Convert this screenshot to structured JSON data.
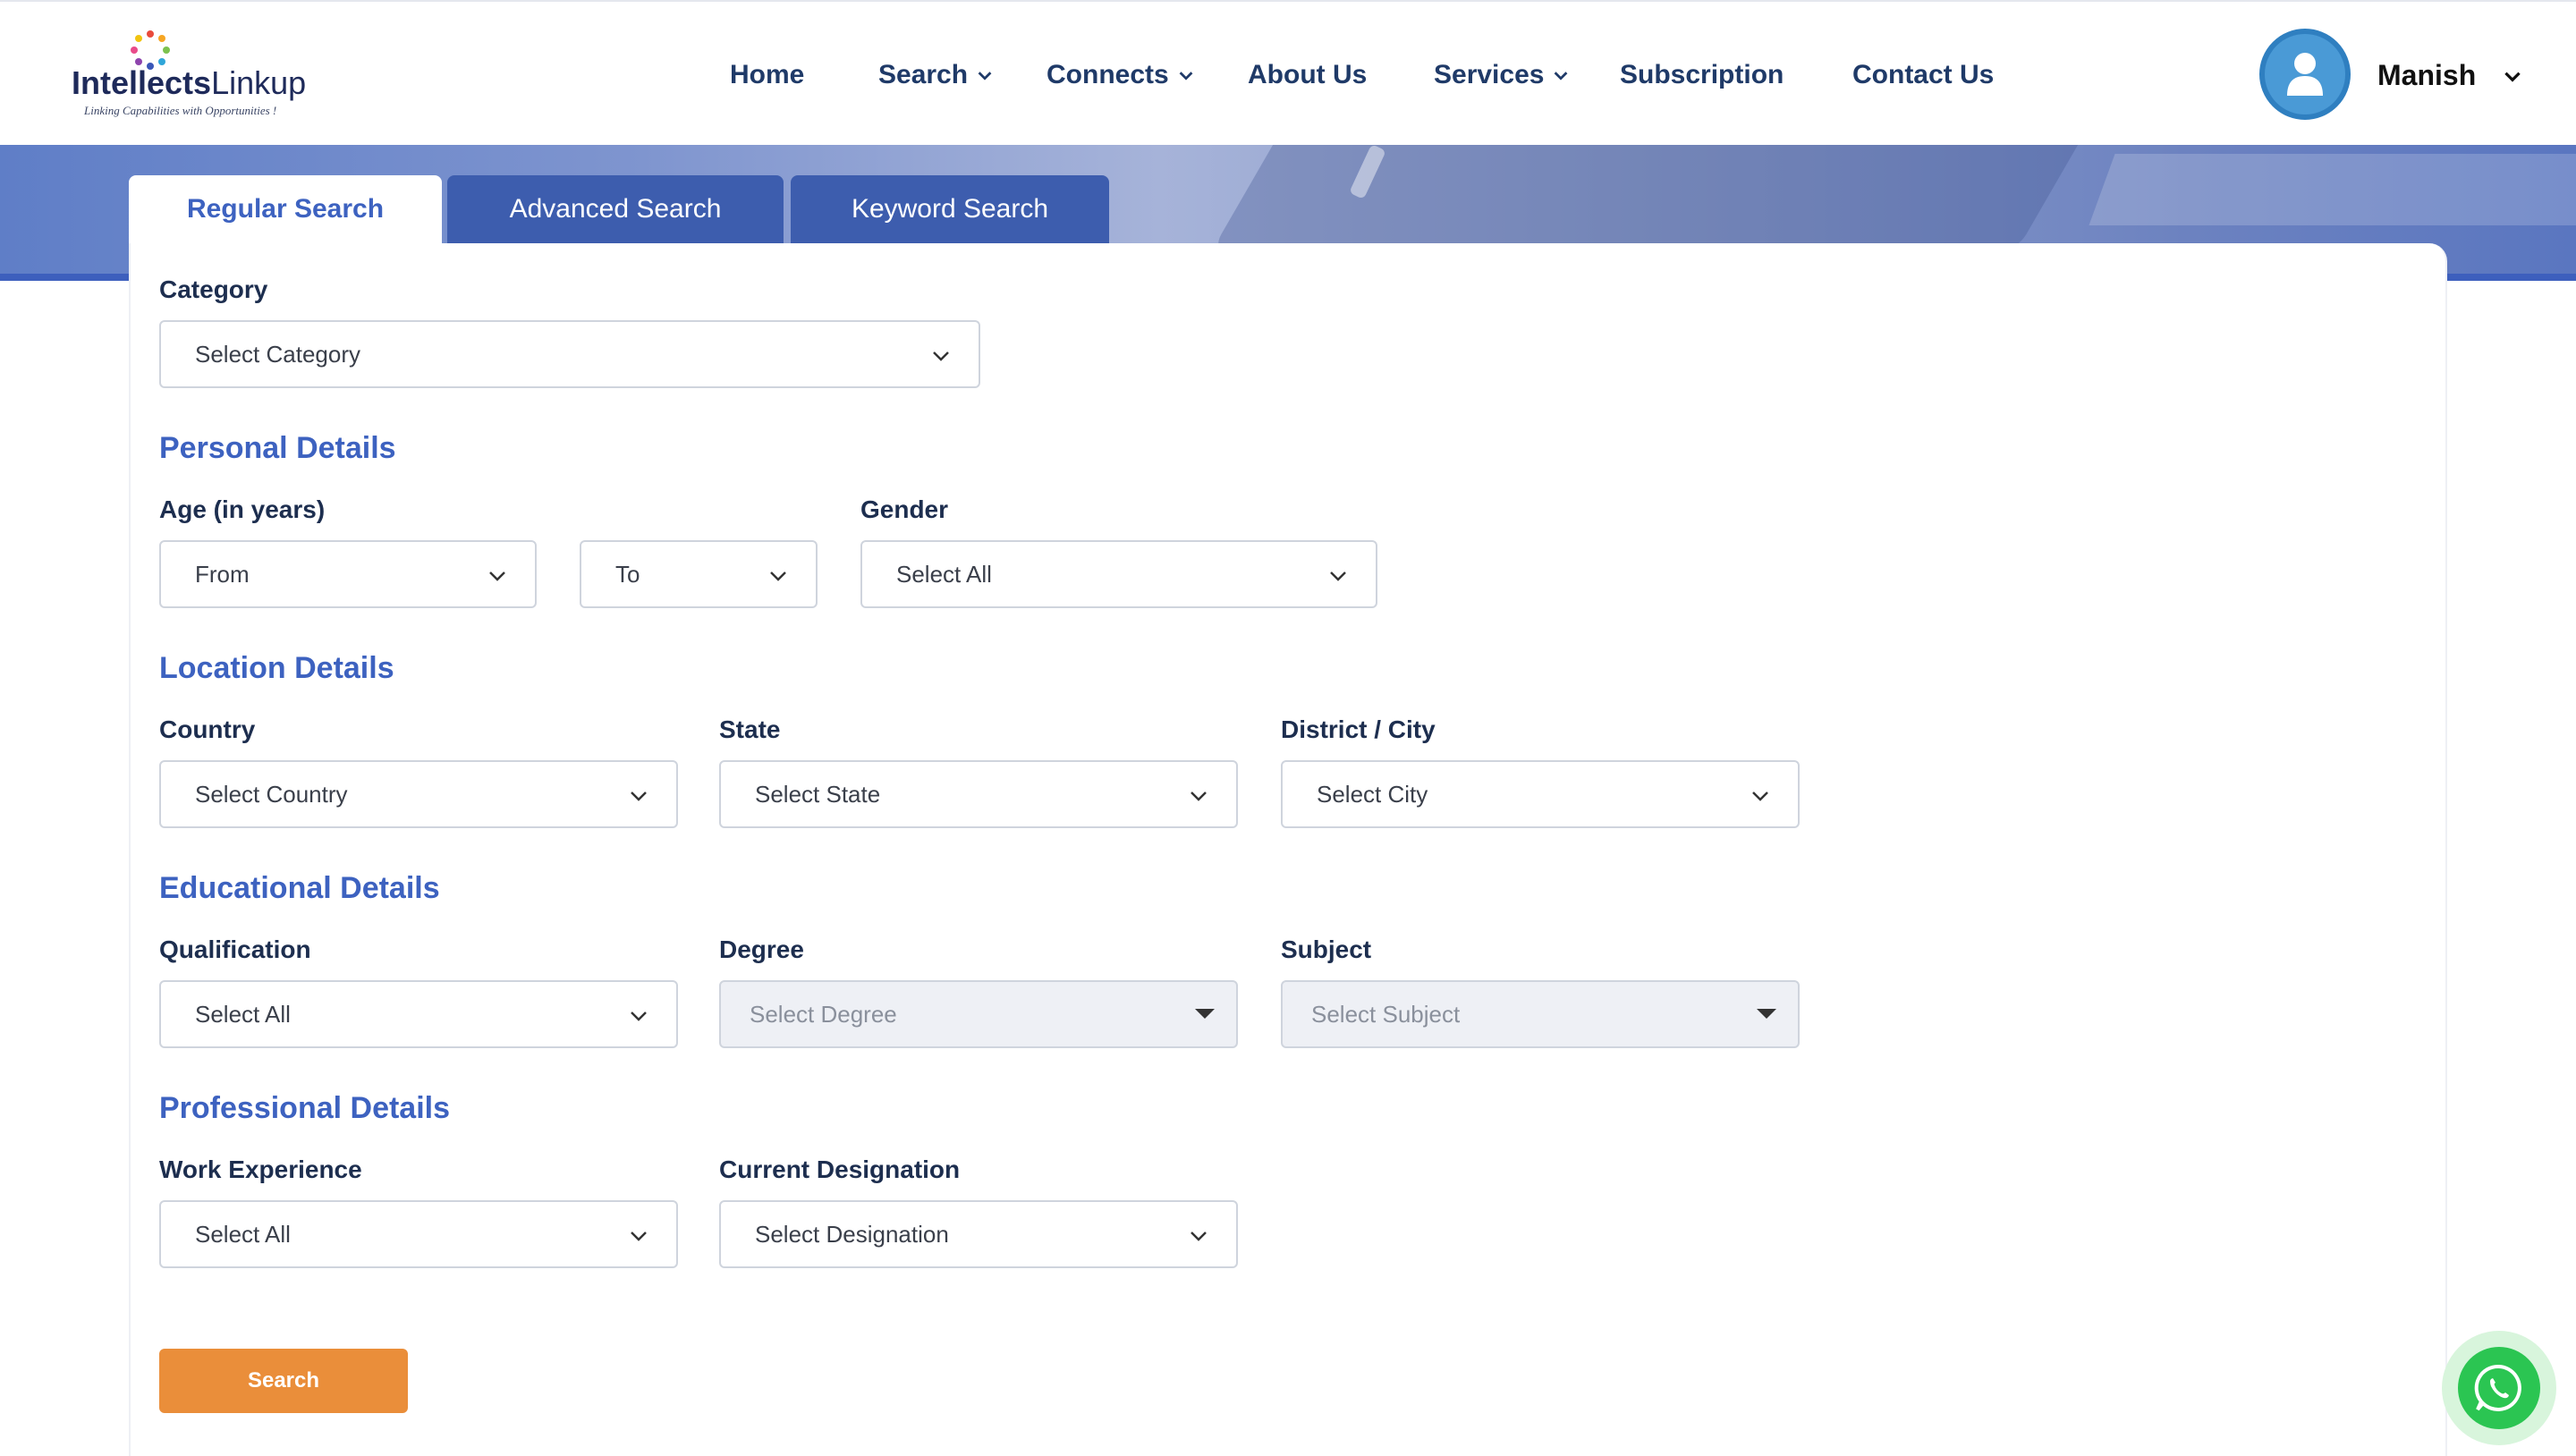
{
  "brand": {
    "name_bold": "Intellects",
    "name_light": "Linkup",
    "tagline": "Linking Capabilities with Opportunities !"
  },
  "nav": {
    "home": "Home",
    "search": "Search",
    "connects": "Connects",
    "about": "About Us",
    "services": "Services",
    "subscription": "Subscription",
    "contact": "Contact Us"
  },
  "user": {
    "name": "Manish"
  },
  "tabs": {
    "regular": "Regular Search",
    "advanced": "Advanced Search",
    "keyword": "Keyword Search"
  },
  "form": {
    "category": {
      "label": "Category",
      "value": "Select Category"
    },
    "personal": {
      "title": "Personal Details",
      "age_label": "Age (in years)",
      "age_from": "From",
      "age_to": "To",
      "gender_label": "Gender",
      "gender_value": "Select All"
    },
    "location": {
      "title": "Location Details",
      "country_label": "Country",
      "country_value": "Select Country",
      "state_label": "State",
      "state_value": "Select State",
      "city_label": "District / City",
      "city_value": "Select City"
    },
    "education": {
      "title": "Educational Details",
      "qualification_label": "Qualification",
      "qualification_value": "Select All",
      "degree_label": "Degree",
      "degree_value": "Select Degree",
      "subject_label": "Subject",
      "subject_value": "Select Subject"
    },
    "professional": {
      "title": "Professional Details",
      "experience_label": "Work Experience",
      "experience_value": "Select All",
      "designation_label": "Current Designation",
      "designation_value": "Select Designation"
    },
    "search_button": "Search"
  },
  "colors": {
    "accent": "#3d62c0",
    "tab_inactive": "#3d5dae",
    "button": "#ea8e3a",
    "whatsapp": "#2bc552"
  },
  "icons": [
    "logo-mark-icon",
    "chevron-down-icon",
    "user-icon",
    "whatsapp-icon"
  ]
}
